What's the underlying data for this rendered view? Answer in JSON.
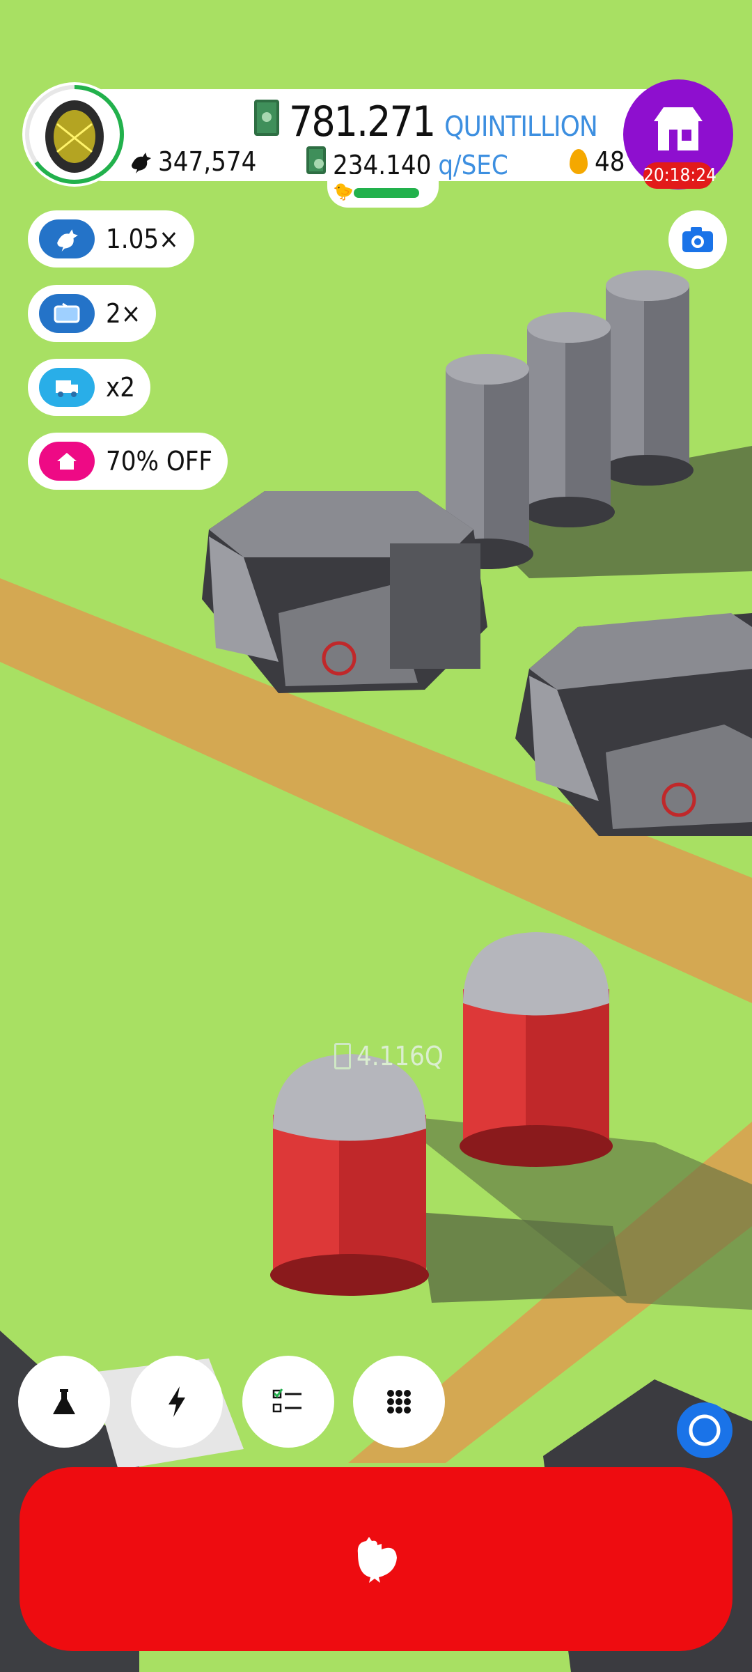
{
  "header": {
    "money_value": "781.271",
    "money_unit": "QUINTILLION",
    "chicken_count": "347,574",
    "rate_value": "234.140",
    "rate_unit": "q/SEC",
    "golden_eggs": "48",
    "shop_timer": "20:18:24"
  },
  "boosts": [
    {
      "label": "1.05×",
      "icon": "chicken-icon",
      "color": "#2473c8"
    },
    {
      "label": "2×",
      "icon": "tv-icon",
      "color": "#2473c8"
    },
    {
      "label": "x2",
      "icon": "truck-icon",
      "color": "#29aee8"
    },
    {
      "label": "70% OFF",
      "icon": "house-icon",
      "color": "#ee0a85"
    }
  ],
  "world": {
    "floating_value": "4.116Q"
  },
  "toolbar": {
    "buttons": [
      "research-flask-icon",
      "boost-lightning-icon",
      "missions-checklist-icon",
      "menu-grid-icon"
    ]
  },
  "colors": {
    "grass": "#a8e063",
    "road": "#d4a852",
    "shop": "#8e0fcf",
    "hatch_button": "#ee0c10",
    "accent_blue": "#3d8fe0"
  }
}
